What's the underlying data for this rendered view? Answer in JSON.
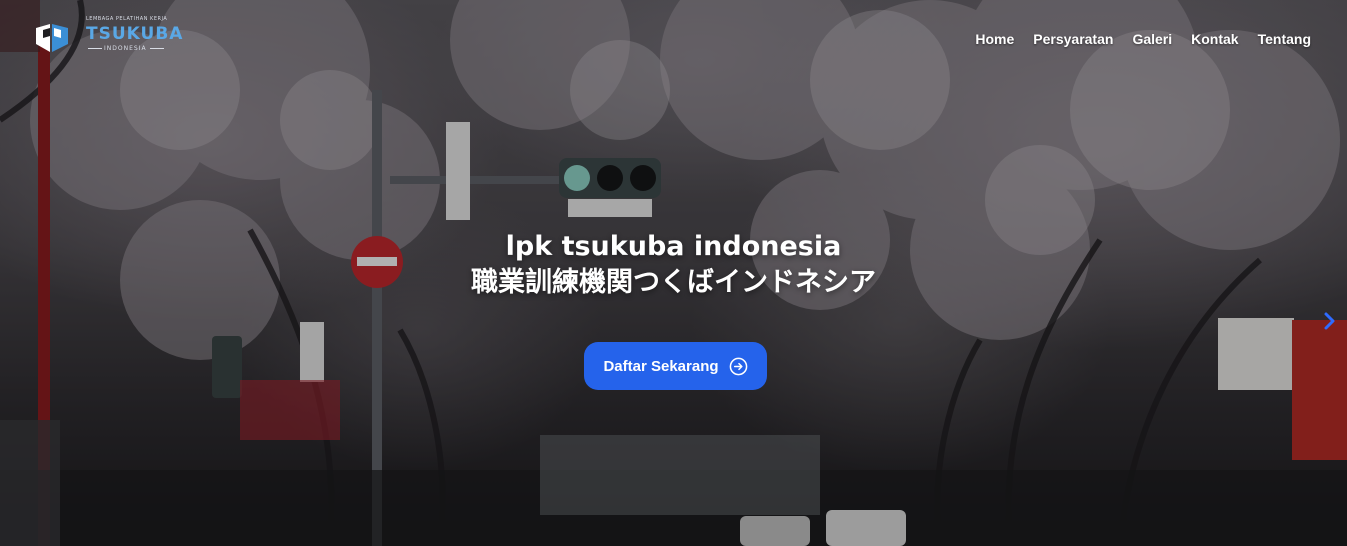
{
  "logo": {
    "tagline": "LEMBAGA PELATIHAN KERJA",
    "brand": "TSUKUBA",
    "sub": "INDONESIA",
    "mark_icon": "tsukuba-logo-mark-icon"
  },
  "nav": {
    "items": [
      "Home",
      "Persyaratan",
      "Galeri",
      "Kontak",
      "Tentang"
    ]
  },
  "hero": {
    "title_line1": "lpk tsukuba indonesia",
    "title_line2": "職業訓練機関つくばインドネシア",
    "cta_label": "Daftar Sekarang",
    "cta_icon": "arrow-right-circle-icon",
    "next_icon": "chevron-right-icon"
  },
  "colors": {
    "accent": "#2563eb",
    "brand_blue": "#5aa8e6"
  }
}
